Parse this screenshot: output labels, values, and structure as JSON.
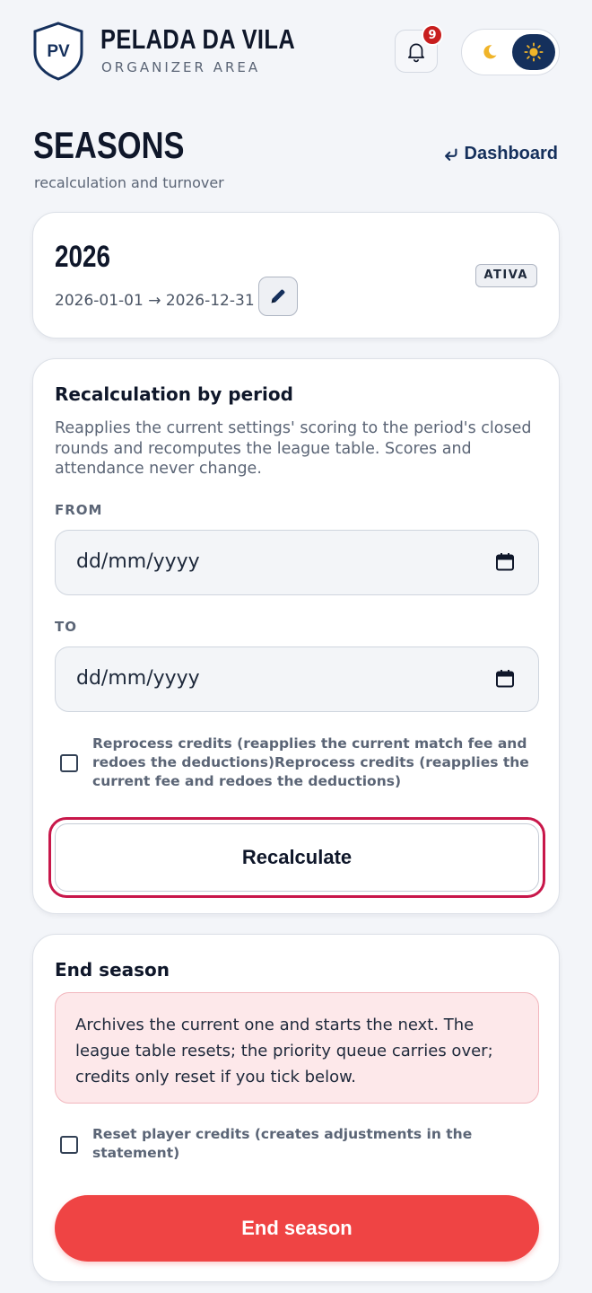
{
  "header": {
    "logo_text": "PV",
    "title": "PELADA DA VILA",
    "subtitle": "ORGANIZER AREA",
    "notifications_count": "9",
    "theme": {
      "moon_icon": "moon-icon",
      "sun_icon": "sun-icon",
      "active": "light"
    }
  },
  "page": {
    "title": "SEASONS",
    "subtitle": "recalculation and turnover",
    "dashboard_link": "Dashboard",
    "dashboard_icon": "return-arrow-icon"
  },
  "season": {
    "year": "2026",
    "dates": "2026-01-01 → 2026-12-31",
    "status": "ATIVA",
    "edit_icon": "pencil-icon"
  },
  "recalculation": {
    "heading": "Recalculation by period",
    "description": "Reapplies the current settings' scoring to the period's closed rounds and recomputes the league table. Scores and attendance never change.",
    "from_label": "FROM",
    "from_value": "dd/mm/yyyy",
    "to_label": "TO",
    "to_value": "dd/mm/yyyy",
    "credits_checkbox_label": "Reprocess credits (reapplies the current match fee and redoes the deductions)Reprocess credits (reapplies the current fee and redoes the deductions)",
    "credits_checked": false,
    "button_label": "Recalculate"
  },
  "end_season": {
    "heading": "End season",
    "alert": "Archives the current one and starts the next. The league table resets; the priority queue carries over; credits only reset if you tick below.",
    "reset_checkbox_label": "Reset player credits (creates adjustments in the statement)",
    "reset_checked": false,
    "button_label": "End season"
  },
  "colors": {
    "navy": "#15305c",
    "danger": "#ef4444",
    "focus_ring": "#c8174a",
    "badge": "#c81e1e",
    "alert_bg": "#fde8ea"
  }
}
